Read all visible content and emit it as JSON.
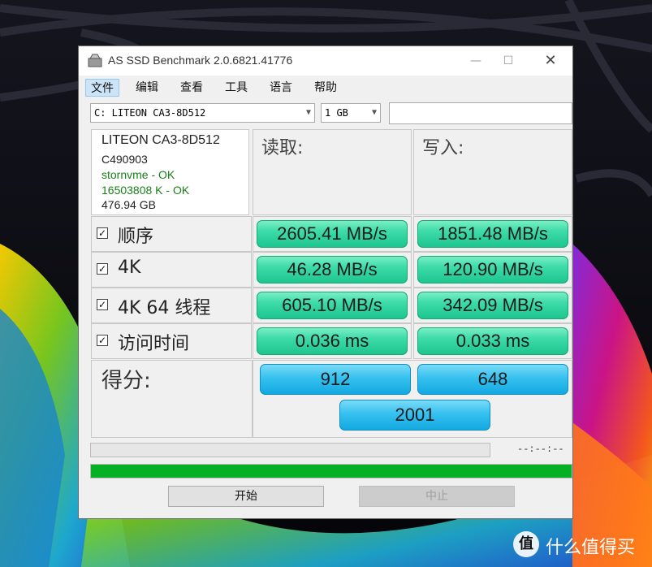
{
  "window": {
    "title": "AS SSD Benchmark 2.0.6821.41776",
    "min_glyph": "—",
    "max_glyph": "☐",
    "close_glyph": "✕"
  },
  "menu": [
    "文件",
    "编辑",
    "查看",
    "工具",
    "语言",
    "帮助"
  ],
  "menu_active_index": 0,
  "drive_select": {
    "value": "C: LITEON CA3-8D512"
  },
  "size_select": {
    "value": "1 GB"
  },
  "drive_info": {
    "model": "LITEON CA3-8D512",
    "firmware": "C490903",
    "driver": "stornvme - OK",
    "alignment": "16503808 K - OK",
    "capacity": "476.94 GB",
    "ok_color": "#1a7f1a"
  },
  "columns": {
    "read": "读取:",
    "write": "写入:"
  },
  "rows": [
    {
      "label": "顺序",
      "checked": true,
      "read": "2605.41 MB/s",
      "write": "1851.48 MB/s"
    },
    {
      "label": "4K",
      "checked": true,
      "read": "46.28 MB/s",
      "write": "120.90 MB/s"
    },
    {
      "label": "4K 64 线程",
      "checked": true,
      "read": "605.10 MB/s",
      "write": "342.09 MB/s"
    },
    {
      "label": "访问时间",
      "checked": true,
      "read": "0.036 ms",
      "write": "0.033 ms"
    }
  ],
  "score": {
    "label": "得分:",
    "read": "912",
    "write": "648",
    "total": "2001"
  },
  "status": {
    "time": "--:--:--",
    "progress_fraction": 1.0,
    "progress_color": "#06b025"
  },
  "buttons": {
    "start": "开始",
    "stop": "中止"
  },
  "watermark": {
    "logo": "值",
    "text": "什么值得买"
  },
  "colors": {
    "result_green": "#3ddba8",
    "score_blue": "#36c1ef"
  }
}
